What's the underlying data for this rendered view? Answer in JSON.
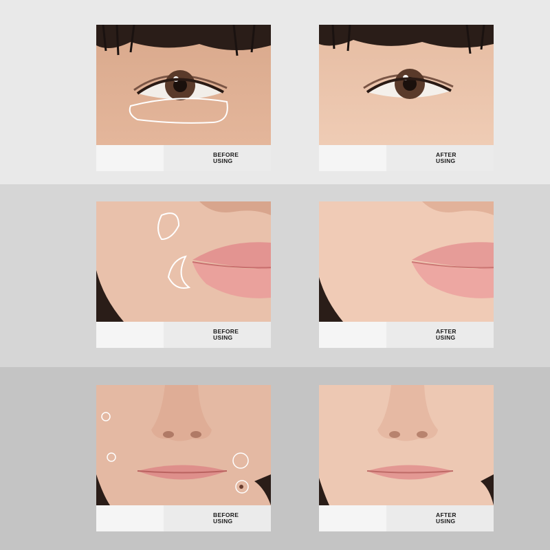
{
  "rows": [
    {
      "area": "under-eye",
      "before": {
        "line1": "BEFORE",
        "line2": "USING"
      },
      "after": {
        "line1": "AFTER",
        "line2": "USING"
      }
    },
    {
      "area": "cheek-and-lips",
      "before": {
        "line1": "BEFORE",
        "line2": "USING"
      },
      "after": {
        "line1": "AFTER",
        "line2": "USING"
      }
    },
    {
      "area": "nose-and-cheeks",
      "before": {
        "line1": "BEFORE",
        "line2": "USING"
      },
      "after": {
        "line1": "AFTER",
        "line2": "USING"
      }
    }
  ],
  "colors": {
    "band_light": "#e9e9e9",
    "band_mid": "#d6d6d6",
    "band_dark": "#c4c4c4",
    "skin": "#e9c3ac",
    "lips": "#e39a97",
    "highlight_outline": "#ffffff"
  }
}
